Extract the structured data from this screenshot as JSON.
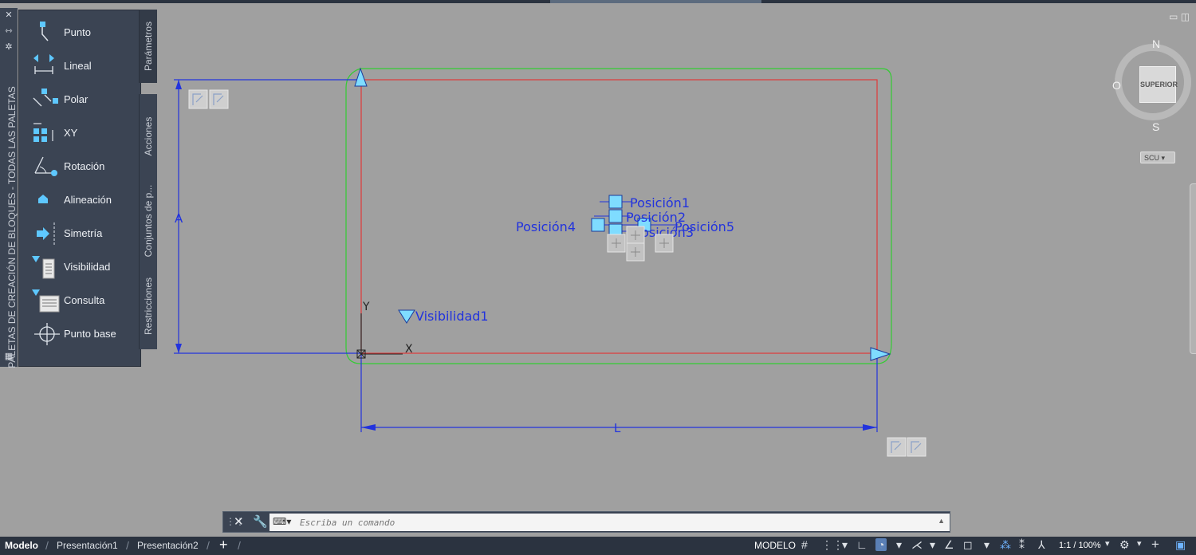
{
  "palette": {
    "title": "PALETAS DE CREACIÓN DE BLOQUES - TODAS LAS PALETAS",
    "tools": [
      {
        "label": "Punto",
        "icon": "point-parameter-icon"
      },
      {
        "label": "Lineal",
        "icon": "linear-parameter-icon"
      },
      {
        "label": "Polar",
        "icon": "polar-parameter-icon"
      },
      {
        "label": "XY",
        "icon": "xy-parameter-icon"
      },
      {
        "label": "Rotación",
        "icon": "rotation-parameter-icon"
      },
      {
        "label": "Alineación",
        "icon": "alignment-parameter-icon"
      },
      {
        "label": "Simetría",
        "icon": "flip-parameter-icon"
      },
      {
        "label": "Visibilidad",
        "icon": "visibility-parameter-icon"
      },
      {
        "label": "Consulta",
        "icon": "lookup-parameter-icon"
      },
      {
        "label": "Punto base",
        "icon": "base-point-icon"
      }
    ],
    "tabs": [
      "Parámetros",
      "Acciones",
      "Conjuntos de p...",
      "Restricciones"
    ],
    "active_tab": "Parámetros"
  },
  "drawing": {
    "dim_height_label": "A",
    "dim_length_label": "L",
    "axis_x": "X",
    "axis_y": "Y",
    "visibility_label": "Visibilidad1",
    "positions": [
      "Posición1",
      "Posición2",
      "Posición3",
      "Posición4",
      "Posición5"
    ],
    "colors": {
      "red": "#e03a3a",
      "green": "#33cc33",
      "blue": "#2233dd",
      "grip": "#7fdcff"
    }
  },
  "viewcube": {
    "north": "N",
    "south": "S",
    "west": "O",
    "face": "SUPERIOR",
    "ucs": "SCU"
  },
  "command": {
    "placeholder": "Escriba un comando"
  },
  "status": {
    "tabs": [
      "Modelo",
      "Presentación1",
      "Presentación2"
    ],
    "space": "MODELO",
    "scale": "1:1 / 100%"
  }
}
